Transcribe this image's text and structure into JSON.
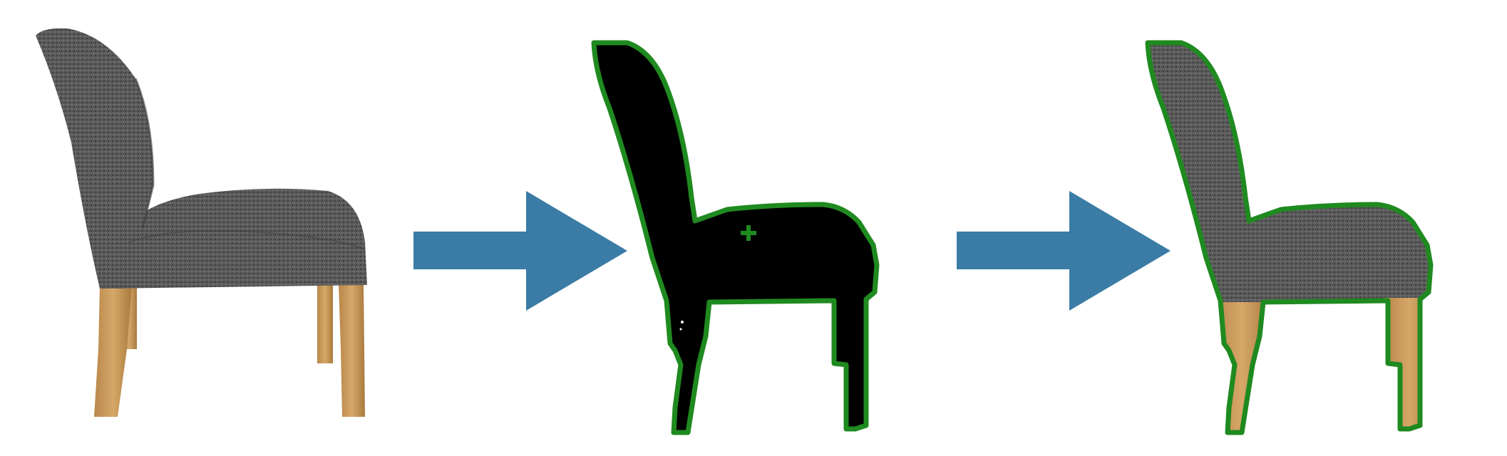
{
  "panels": [
    {
      "id": "original",
      "icon": "chair-photo",
      "description_visible": false
    },
    {
      "id": "mask",
      "icon": "chair-mask",
      "point_prompt": "plus-marker"
    },
    {
      "id": "segmented",
      "icon": "chair-segmented"
    }
  ],
  "arrows": [
    {
      "id": "arrow-1",
      "icon": "right-arrow-icon"
    },
    {
      "id": "arrow-2",
      "icon": "right-arrow-icon"
    }
  ],
  "colors": {
    "background": "#ffffff",
    "arrow": "#3a7ca5",
    "outline": "#1f8a1f",
    "mask_fill": "#000000",
    "fabric_dark": "#4a4a4a",
    "fabric_mid": "#6b6b6b",
    "wood": "#c89a5a",
    "wood_dark": "#a97a3e"
  }
}
